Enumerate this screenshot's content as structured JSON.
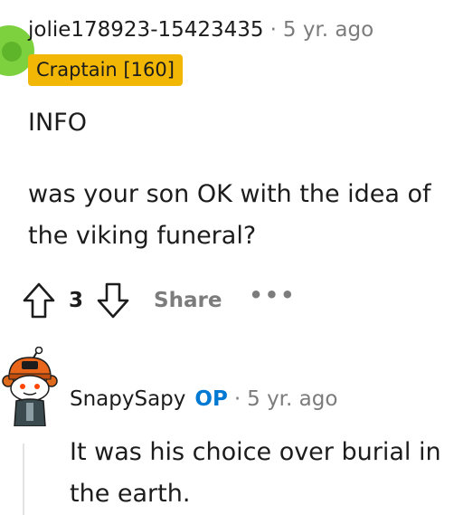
{
  "comment": {
    "username": "jolie178923-15423435",
    "separator": "·",
    "time_ago": "5 yr. ago",
    "flair": "Craptain [160]",
    "body_line1": "INFO",
    "body_line2": "was your son OK with the idea of the viking funeral?",
    "actions": {
      "upvote_icon": "arrow-up-icon",
      "vote_count": "3",
      "downvote_icon": "arrow-down-icon",
      "share_label": "Share",
      "more_label": "•••"
    }
  },
  "reply": {
    "username": "SnapySapy",
    "op_badge": "OP",
    "separator": "·",
    "time_ago": "5 yr. ago",
    "body": "It was his choice over burial in the earth."
  },
  "colors": {
    "flair_bg": "#f2b705",
    "op_blue": "#0079d3",
    "meta_gray": "#7c7c7c",
    "avatar_green": "#7dd13f"
  }
}
